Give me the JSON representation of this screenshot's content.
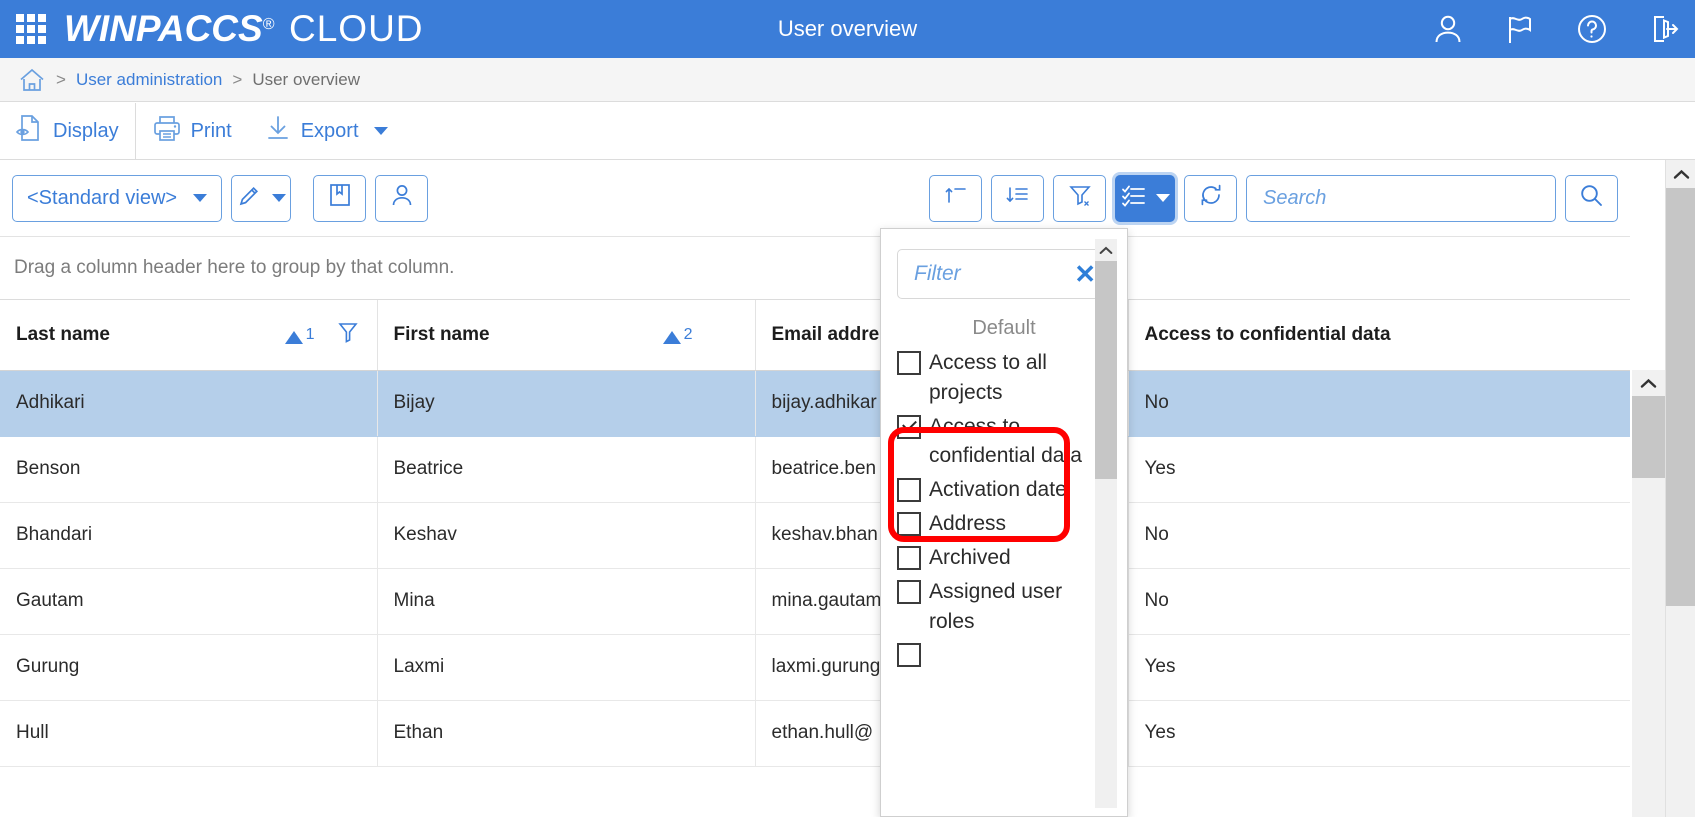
{
  "topbar": {
    "launcher_icon": "apps-grid-icon",
    "brand_primary": "WINPACCS",
    "brand_registered": "®",
    "brand_secondary": "CLOUD",
    "page_title": "User overview",
    "icons": [
      {
        "name": "user-account-icon",
        "label": "User account"
      },
      {
        "name": "flag-icon",
        "label": "Language"
      },
      {
        "name": "help-icon",
        "label": "Help"
      },
      {
        "name": "logout-icon",
        "label": "Log out"
      }
    ]
  },
  "breadcrumb": {
    "home_icon": "home-icon",
    "separator": ">",
    "items": [
      {
        "label": "User administration",
        "current": false
      },
      {
        "label": "User overview",
        "current": true
      }
    ]
  },
  "actionbar": {
    "items": [
      {
        "label": "Display",
        "icon": "display-preview-icon",
        "has_caret": false
      },
      {
        "label": "Print",
        "icon": "printer-icon",
        "has_caret": false
      },
      {
        "label": "Export",
        "icon": "download-icon",
        "has_caret": true
      }
    ]
  },
  "gridtoolbar": {
    "view_selector": {
      "label": "<Standard view>",
      "icon": "chevron-down-icon"
    },
    "edit_button": {
      "name": "pencil-edit-button",
      "icon": "pencil-icon",
      "has_caret": true
    },
    "bookmark_button": {
      "name": "book-button",
      "icon": "book-icon"
    },
    "user_button": {
      "name": "user-button",
      "icon": "user-icon"
    },
    "sort_single_button": {
      "name": "sort-button",
      "icon": "sort-icon"
    },
    "sort_multi_button": {
      "name": "multi-sort-button",
      "icon": "multi-sort-icon"
    },
    "clear_filter_button": {
      "name": "clear-filter-button",
      "icon": "funnel-clear-icon"
    },
    "column_chooser_button": {
      "name": "column-chooser-button",
      "icon": "checklist-icon",
      "pressed": true,
      "has_caret": true
    },
    "refresh_button": {
      "name": "refresh-button",
      "icon": "refresh-icon"
    },
    "search": {
      "value": "",
      "placeholder": "Search"
    },
    "search_go_button": {
      "name": "search-button",
      "icon": "magnifier-icon"
    }
  },
  "grouppanel": {
    "text": "Drag a column header here to group by that column."
  },
  "grid": {
    "columns": [
      {
        "label": "Last name",
        "sort": "asc",
        "sort_order": "1",
        "has_filter_icon": true
      },
      {
        "label": "First name",
        "sort": "asc",
        "sort_order": "2",
        "has_filter_icon": false
      },
      {
        "label": "Email addre",
        "sort": null,
        "sort_order": null,
        "has_filter_icon": false
      },
      {
        "label": "Access to confidential data",
        "sort": null,
        "sort_order": null,
        "has_filter_icon": false
      }
    ],
    "rows": [
      {
        "last_name": "Adhikari",
        "first_name": "Bijay",
        "email": "bijay.adhikar",
        "confidential": "No",
        "selected": true
      },
      {
        "last_name": "Benson",
        "first_name": "Beatrice",
        "email": "beatrice.ben",
        "confidential": "Yes",
        "selected": false
      },
      {
        "last_name": "Bhandari",
        "first_name": "Keshav",
        "email": "keshav.bhan",
        "confidential": "No",
        "selected": false
      },
      {
        "last_name": "Gautam",
        "first_name": "Mina",
        "email": "mina.gautam",
        "confidential": "No",
        "selected": false
      },
      {
        "last_name": "Gurung",
        "first_name": "Laxmi",
        "email": "laxmi.gurung",
        "confidential": "Yes",
        "selected": false
      },
      {
        "last_name": "Hull",
        "first_name": "Ethan",
        "email": "ethan.hull@",
        "confidential": "Yes",
        "selected": false
      }
    ]
  },
  "column_chooser": {
    "filter": {
      "value": "",
      "placeholder": "Filter"
    },
    "clear_label": "✕",
    "section_label": "Default",
    "items": [
      {
        "label": "Access to all projects",
        "checked": false
      },
      {
        "label": "Access to confidential data",
        "checked": true
      },
      {
        "label": "Activation date",
        "checked": false
      },
      {
        "label": "Address",
        "checked": false
      },
      {
        "label": "Archived",
        "checked": false
      },
      {
        "label": "Assigned user roles",
        "checked": false
      },
      {
        "label": "",
        "checked": false
      }
    ]
  },
  "colors": {
    "brand_blue": "#3b7dd8",
    "selected_row": "#b5cfea",
    "highlight_red": "#ff0000",
    "scrollbar_thumb": "#c6c6c6"
  }
}
